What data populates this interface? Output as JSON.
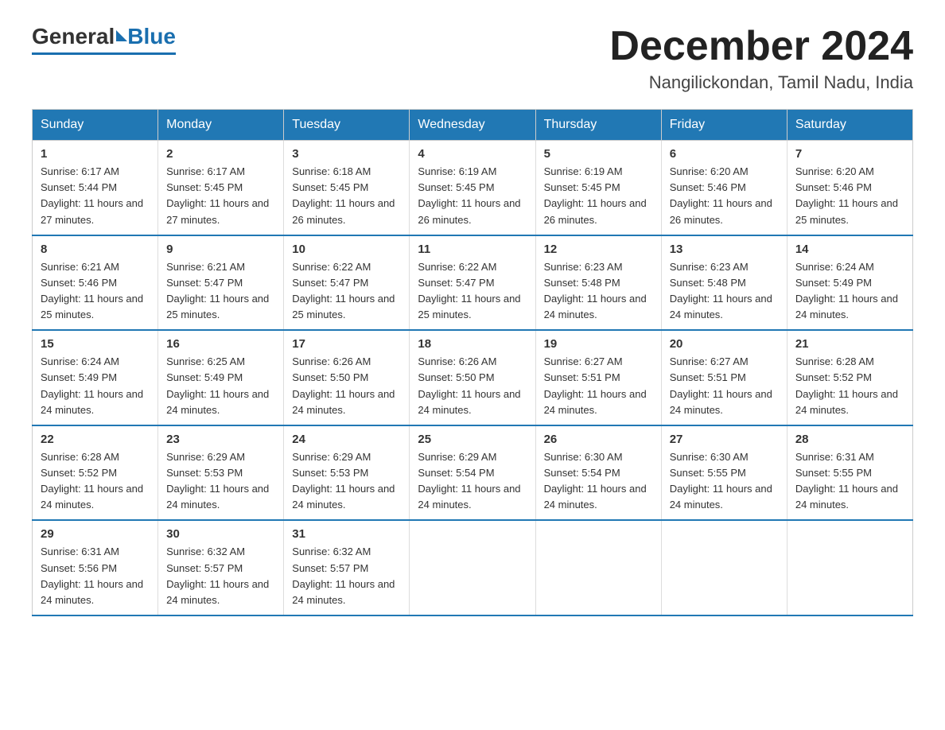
{
  "header": {
    "logo_general": "General",
    "logo_blue": "Blue",
    "month_title": "December 2024",
    "location": "Nangilickondan, Tamil Nadu, India"
  },
  "weekdays": [
    "Sunday",
    "Monday",
    "Tuesday",
    "Wednesday",
    "Thursday",
    "Friday",
    "Saturday"
  ],
  "weeks": [
    [
      {
        "day": "1",
        "sunrise": "6:17 AM",
        "sunset": "5:44 PM",
        "daylight": "11 hours and 27 minutes."
      },
      {
        "day": "2",
        "sunrise": "6:17 AM",
        "sunset": "5:45 PM",
        "daylight": "11 hours and 27 minutes."
      },
      {
        "day": "3",
        "sunrise": "6:18 AM",
        "sunset": "5:45 PM",
        "daylight": "11 hours and 26 minutes."
      },
      {
        "day": "4",
        "sunrise": "6:19 AM",
        "sunset": "5:45 PM",
        "daylight": "11 hours and 26 minutes."
      },
      {
        "day": "5",
        "sunrise": "6:19 AM",
        "sunset": "5:45 PM",
        "daylight": "11 hours and 26 minutes."
      },
      {
        "day": "6",
        "sunrise": "6:20 AM",
        "sunset": "5:46 PM",
        "daylight": "11 hours and 26 minutes."
      },
      {
        "day": "7",
        "sunrise": "6:20 AM",
        "sunset": "5:46 PM",
        "daylight": "11 hours and 25 minutes."
      }
    ],
    [
      {
        "day": "8",
        "sunrise": "6:21 AM",
        "sunset": "5:46 PM",
        "daylight": "11 hours and 25 minutes."
      },
      {
        "day": "9",
        "sunrise": "6:21 AM",
        "sunset": "5:47 PM",
        "daylight": "11 hours and 25 minutes."
      },
      {
        "day": "10",
        "sunrise": "6:22 AM",
        "sunset": "5:47 PM",
        "daylight": "11 hours and 25 minutes."
      },
      {
        "day": "11",
        "sunrise": "6:22 AM",
        "sunset": "5:47 PM",
        "daylight": "11 hours and 25 minutes."
      },
      {
        "day": "12",
        "sunrise": "6:23 AM",
        "sunset": "5:48 PM",
        "daylight": "11 hours and 24 minutes."
      },
      {
        "day": "13",
        "sunrise": "6:23 AM",
        "sunset": "5:48 PM",
        "daylight": "11 hours and 24 minutes."
      },
      {
        "day": "14",
        "sunrise": "6:24 AM",
        "sunset": "5:49 PM",
        "daylight": "11 hours and 24 minutes."
      }
    ],
    [
      {
        "day": "15",
        "sunrise": "6:24 AM",
        "sunset": "5:49 PM",
        "daylight": "11 hours and 24 minutes."
      },
      {
        "day": "16",
        "sunrise": "6:25 AM",
        "sunset": "5:49 PM",
        "daylight": "11 hours and 24 minutes."
      },
      {
        "day": "17",
        "sunrise": "6:26 AM",
        "sunset": "5:50 PM",
        "daylight": "11 hours and 24 minutes."
      },
      {
        "day": "18",
        "sunrise": "6:26 AM",
        "sunset": "5:50 PM",
        "daylight": "11 hours and 24 minutes."
      },
      {
        "day": "19",
        "sunrise": "6:27 AM",
        "sunset": "5:51 PM",
        "daylight": "11 hours and 24 minutes."
      },
      {
        "day": "20",
        "sunrise": "6:27 AM",
        "sunset": "5:51 PM",
        "daylight": "11 hours and 24 minutes."
      },
      {
        "day": "21",
        "sunrise": "6:28 AM",
        "sunset": "5:52 PM",
        "daylight": "11 hours and 24 minutes."
      }
    ],
    [
      {
        "day": "22",
        "sunrise": "6:28 AM",
        "sunset": "5:52 PM",
        "daylight": "11 hours and 24 minutes."
      },
      {
        "day": "23",
        "sunrise": "6:29 AM",
        "sunset": "5:53 PM",
        "daylight": "11 hours and 24 minutes."
      },
      {
        "day": "24",
        "sunrise": "6:29 AM",
        "sunset": "5:53 PM",
        "daylight": "11 hours and 24 minutes."
      },
      {
        "day": "25",
        "sunrise": "6:29 AM",
        "sunset": "5:54 PM",
        "daylight": "11 hours and 24 minutes."
      },
      {
        "day": "26",
        "sunrise": "6:30 AM",
        "sunset": "5:54 PM",
        "daylight": "11 hours and 24 minutes."
      },
      {
        "day": "27",
        "sunrise": "6:30 AM",
        "sunset": "5:55 PM",
        "daylight": "11 hours and 24 minutes."
      },
      {
        "day": "28",
        "sunrise": "6:31 AM",
        "sunset": "5:55 PM",
        "daylight": "11 hours and 24 minutes."
      }
    ],
    [
      {
        "day": "29",
        "sunrise": "6:31 AM",
        "sunset": "5:56 PM",
        "daylight": "11 hours and 24 minutes."
      },
      {
        "day": "30",
        "sunrise": "6:32 AM",
        "sunset": "5:57 PM",
        "daylight": "11 hours and 24 minutes."
      },
      {
        "day": "31",
        "sunrise": "6:32 AM",
        "sunset": "5:57 PM",
        "daylight": "11 hours and 24 minutes."
      },
      null,
      null,
      null,
      null
    ]
  ]
}
